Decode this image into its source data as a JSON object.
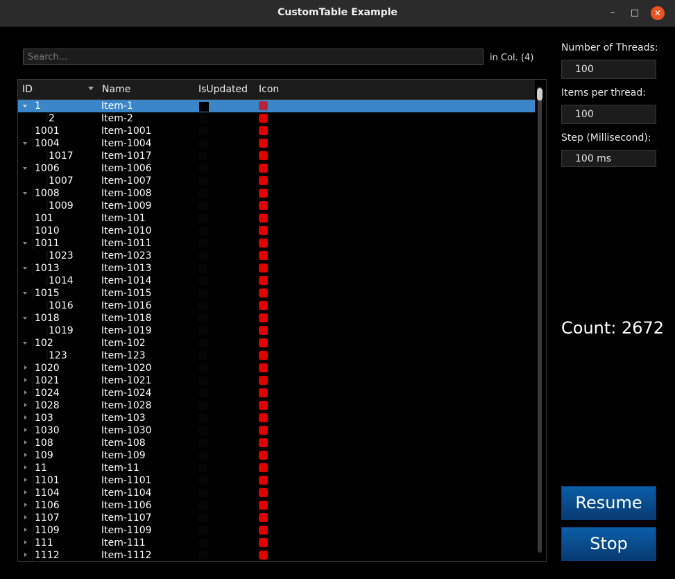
{
  "window": {
    "title": "CustomTable Example",
    "minimize": "–",
    "maximize": "□",
    "close": "✕"
  },
  "search": {
    "placeholder": "Search...",
    "value": "",
    "column_label": "in Col. (4)"
  },
  "tree": {
    "headers": {
      "id": "ID",
      "name": "Name",
      "is_updated": "IsUpdated",
      "icon": "Icon"
    },
    "sort_column": "ID",
    "sort_order": "descending",
    "icon_color": "#e00000",
    "selected_color": "#3b86c8",
    "rows": [
      {
        "id": "1",
        "name": "Item-1",
        "level": 0,
        "expander": "down",
        "selected": true
      },
      {
        "id": "2",
        "name": "Item-2",
        "level": 1,
        "expander": "none"
      },
      {
        "id": "1001",
        "name": "Item-1001",
        "level": 0,
        "expander": "none"
      },
      {
        "id": "1004",
        "name": "Item-1004",
        "level": 0,
        "expander": "down"
      },
      {
        "id": "1017",
        "name": "Item-1017",
        "level": 1,
        "expander": "none"
      },
      {
        "id": "1006",
        "name": "Item-1006",
        "level": 0,
        "expander": "down"
      },
      {
        "id": "1007",
        "name": "Item-1007",
        "level": 1,
        "expander": "none"
      },
      {
        "id": "1008",
        "name": "Item-1008",
        "level": 0,
        "expander": "down"
      },
      {
        "id": "1009",
        "name": "Item-1009",
        "level": 1,
        "expander": "none"
      },
      {
        "id": "101",
        "name": "Item-101",
        "level": 0,
        "expander": "none"
      },
      {
        "id": "1010",
        "name": "Item-1010",
        "level": 0,
        "expander": "none"
      },
      {
        "id": "1011",
        "name": "Item-1011",
        "level": 0,
        "expander": "down"
      },
      {
        "id": "1023",
        "name": "Item-1023",
        "level": 1,
        "expander": "none"
      },
      {
        "id": "1013",
        "name": "Item-1013",
        "level": 0,
        "expander": "down"
      },
      {
        "id": "1014",
        "name": "Item-1014",
        "level": 1,
        "expander": "none"
      },
      {
        "id": "1015",
        "name": "Item-1015",
        "level": 0,
        "expander": "down"
      },
      {
        "id": "1016",
        "name": "Item-1016",
        "level": 1,
        "expander": "none"
      },
      {
        "id": "1018",
        "name": "Item-1018",
        "level": 0,
        "expander": "down"
      },
      {
        "id": "1019",
        "name": "Item-1019",
        "level": 1,
        "expander": "none"
      },
      {
        "id": "102",
        "name": "Item-102",
        "level": 0,
        "expander": "down"
      },
      {
        "id": "123",
        "name": "Item-123",
        "level": 1,
        "expander": "none"
      },
      {
        "id": "1020",
        "name": "Item-1020",
        "level": 0,
        "expander": "right"
      },
      {
        "id": "1021",
        "name": "Item-1021",
        "level": 0,
        "expander": "right"
      },
      {
        "id": "1024",
        "name": "Item-1024",
        "level": 0,
        "expander": "right"
      },
      {
        "id": "1028",
        "name": "Item-1028",
        "level": 0,
        "expander": "right"
      },
      {
        "id": "103",
        "name": "Item-103",
        "level": 0,
        "expander": "right"
      },
      {
        "id": "1030",
        "name": "Item-1030",
        "level": 0,
        "expander": "right"
      },
      {
        "id": "108",
        "name": "Item-108",
        "level": 0,
        "expander": "right"
      },
      {
        "id": "109",
        "name": "Item-109",
        "level": 0,
        "expander": "right"
      },
      {
        "id": "11",
        "name": "Item-11",
        "level": 0,
        "expander": "right"
      },
      {
        "id": "1101",
        "name": "Item-1101",
        "level": 0,
        "expander": "right"
      },
      {
        "id": "1104",
        "name": "Item-1104",
        "level": 0,
        "expander": "right"
      },
      {
        "id": "1106",
        "name": "Item-1106",
        "level": 0,
        "expander": "right"
      },
      {
        "id": "1107",
        "name": "Item-1107",
        "level": 0,
        "expander": "right"
      },
      {
        "id": "1109",
        "name": "Item-1109",
        "level": 0,
        "expander": "right"
      },
      {
        "id": "111",
        "name": "Item-111",
        "level": 0,
        "expander": "right"
      },
      {
        "id": "1112",
        "name": "Item-1112",
        "level": 0,
        "expander": "right"
      }
    ]
  },
  "controls": {
    "threads_label": "Number of Threads:",
    "threads_value": "100",
    "items_label": "Items per thread:",
    "items_value": "100",
    "step_label": "Step (Millisecond):",
    "step_value": "100 ms",
    "count": "Count: 2672",
    "resume_label": "Resume",
    "stop_label": "Stop",
    "button_color": "#0b5ea8"
  }
}
